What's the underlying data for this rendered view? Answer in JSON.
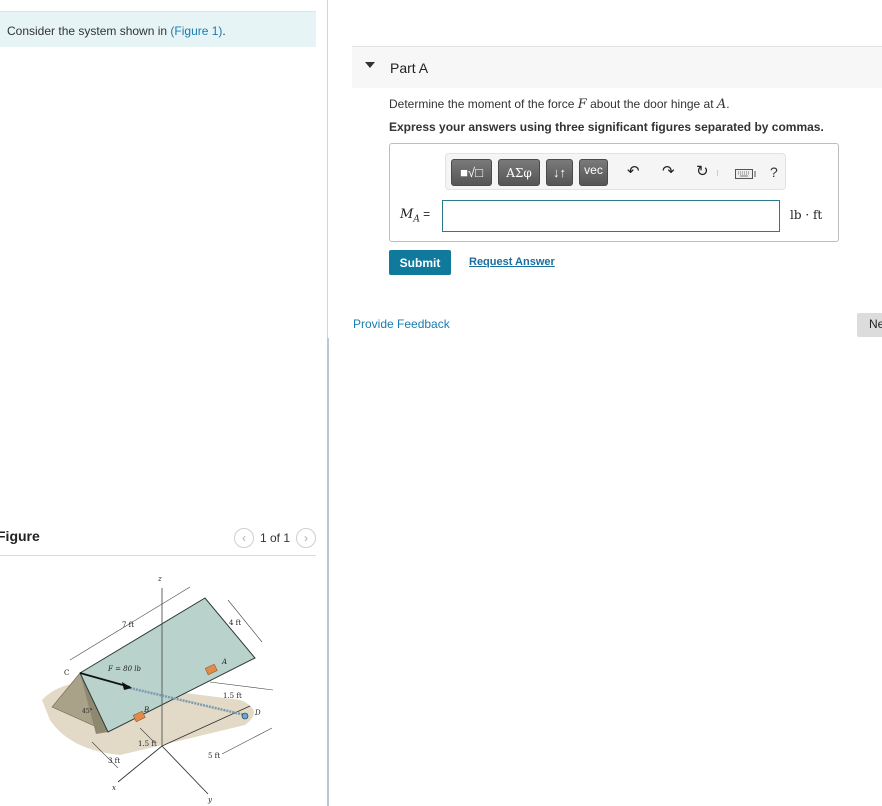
{
  "intro": {
    "text": "Consider the system shown in ",
    "figure_link": "(Figure 1)",
    "suffix": "."
  },
  "figure_panel": {
    "title": "Figure",
    "pager": "1 of 1",
    "prev_icon": "chevron-left-icon",
    "next_icon": "chevron-right-icon",
    "labels": {
      "z": "z",
      "x": "x",
      "y": "y",
      "C": "C",
      "A": "A",
      "B": "B",
      "D": "D",
      "force": "F = 80 lb",
      "dim_7ft": "7 ft",
      "dim_4ft": "4 ft",
      "dim_1_5ft_a": "1.5 ft",
      "dim_1_5ft_b": "1.5 ft",
      "dim_3ft": "3 ft",
      "dim_5ft": "5 ft",
      "angle": "45°"
    },
    "colors": {
      "door": "#b9d2cb",
      "shadow": "#d8cdb5",
      "support": "#a39c84",
      "hinge": "#e08a4c"
    }
  },
  "part": {
    "title": "Part A",
    "question_pre": "Determine the moment of the force ",
    "question_var": "F",
    "question_mid": " about the door hinge at ",
    "question_var2": "A",
    "question_post": ".",
    "instruction": "Express your answers using three significant figures separated by commas."
  },
  "toolbar": {
    "templates": "■√□",
    "greek": "ΑΣφ",
    "arrows": "↓↑",
    "vec": "vec",
    "undo": "↶",
    "redo": "↷",
    "reset": "↻",
    "keyboard": "⌨",
    "help": "?"
  },
  "answer": {
    "label_var": "M",
    "label_sub": "A",
    "label_eq": " =",
    "value": "",
    "unit": "lb · ft"
  },
  "actions": {
    "submit": "Submit",
    "request_answer": "Request Answer",
    "provide_feedback": "Provide Feedback",
    "next": "Ne"
  },
  "colors": {
    "accent": "#0f7a9b",
    "link": "#1a7bb0",
    "intro_bg": "#e6f4f6"
  }
}
